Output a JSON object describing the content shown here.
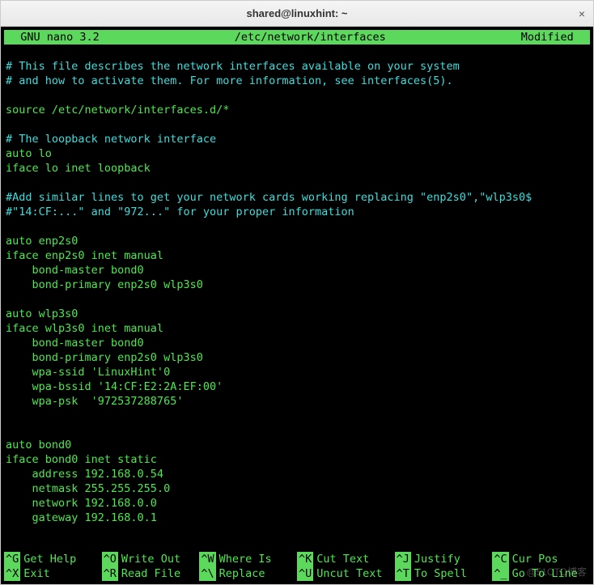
{
  "window": {
    "title": "shared@linuxhint: ~",
    "close": "×"
  },
  "nano": {
    "app": "  GNU nano 3.2",
    "file": "/etc/network/interfaces",
    "status": "Modified  "
  },
  "lines": [
    {
      "t": "plain",
      "v": ""
    },
    {
      "t": "comment",
      "v": "# This file describes the network interfaces available on your system"
    },
    {
      "t": "comment",
      "v": "# and how to activate them. For more information, see interfaces(5)."
    },
    {
      "t": "plain",
      "v": ""
    },
    {
      "t": "plain",
      "v": "source /etc/network/interfaces.d/*"
    },
    {
      "t": "plain",
      "v": ""
    },
    {
      "t": "comment",
      "v": "# The loopback network interface"
    },
    {
      "t": "plain",
      "v": "auto lo"
    },
    {
      "t": "plain",
      "v": "iface lo inet loopback"
    },
    {
      "t": "plain",
      "v": ""
    },
    {
      "t": "comment",
      "v": "#Add similar lines to get your network cards working replacing \"enp2s0\",\"wlp3s0$"
    },
    {
      "t": "comment",
      "v": "#\"14:CF:...\" and \"972...\" for your proper information"
    },
    {
      "t": "plain",
      "v": ""
    },
    {
      "t": "plain",
      "v": "auto enp2s0"
    },
    {
      "t": "plain",
      "v": "iface enp2s0 inet manual"
    },
    {
      "t": "plain",
      "v": "    bond-master bond0"
    },
    {
      "t": "plain",
      "v": "    bond-primary enp2s0 wlp3s0"
    },
    {
      "t": "plain",
      "v": ""
    },
    {
      "t": "plain",
      "v": "auto wlp3s0"
    },
    {
      "t": "plain",
      "v": "iface wlp3s0 inet manual"
    },
    {
      "t": "plain",
      "v": "    bond-master bond0"
    },
    {
      "t": "plain",
      "v": "    bond-primary enp2s0 wlp3s0"
    },
    {
      "t": "plain",
      "v": "    wpa-ssid 'LinuxHint'0"
    },
    {
      "t": "plain",
      "v": "    wpa-bssid '14:CF:E2:2A:EF:00'"
    },
    {
      "t": "plain",
      "v": "    wpa-psk  '972537288765'"
    },
    {
      "t": "plain",
      "v": ""
    },
    {
      "t": "plain",
      "v": ""
    },
    {
      "t": "plain",
      "v": "auto bond0"
    },
    {
      "t": "plain",
      "v": "iface bond0 inet static"
    },
    {
      "t": "plain",
      "v": "    address 192.168.0.54"
    },
    {
      "t": "plain",
      "v": "    netmask 255.255.255.0"
    },
    {
      "t": "plain",
      "v": "    network 192.168.0.0"
    },
    {
      "t": "plain",
      "v": "    gateway 192.168.0.1"
    },
    {
      "t": "plain",
      "v": ""
    },
    {
      "t": "plain",
      "v": ""
    }
  ],
  "shortcuts": [
    {
      "key": "^G",
      "label": "Get Help"
    },
    {
      "key": "^O",
      "label": "Write Out"
    },
    {
      "key": "^W",
      "label": "Where Is"
    },
    {
      "key": "^K",
      "label": "Cut Text"
    },
    {
      "key": "^J",
      "label": "Justify"
    },
    {
      "key": "^C",
      "label": "Cur Pos"
    },
    {
      "key": "^X",
      "label": "Exit"
    },
    {
      "key": "^R",
      "label": "Read File"
    },
    {
      "key": "^\\",
      "label": "Replace"
    },
    {
      "key": "^U",
      "label": "Uncut Text"
    },
    {
      "key": "^T",
      "label": "To Spell"
    },
    {
      "key": "^_",
      "label": "Go To Line"
    }
  ],
  "watermark": "@51CTO博客"
}
